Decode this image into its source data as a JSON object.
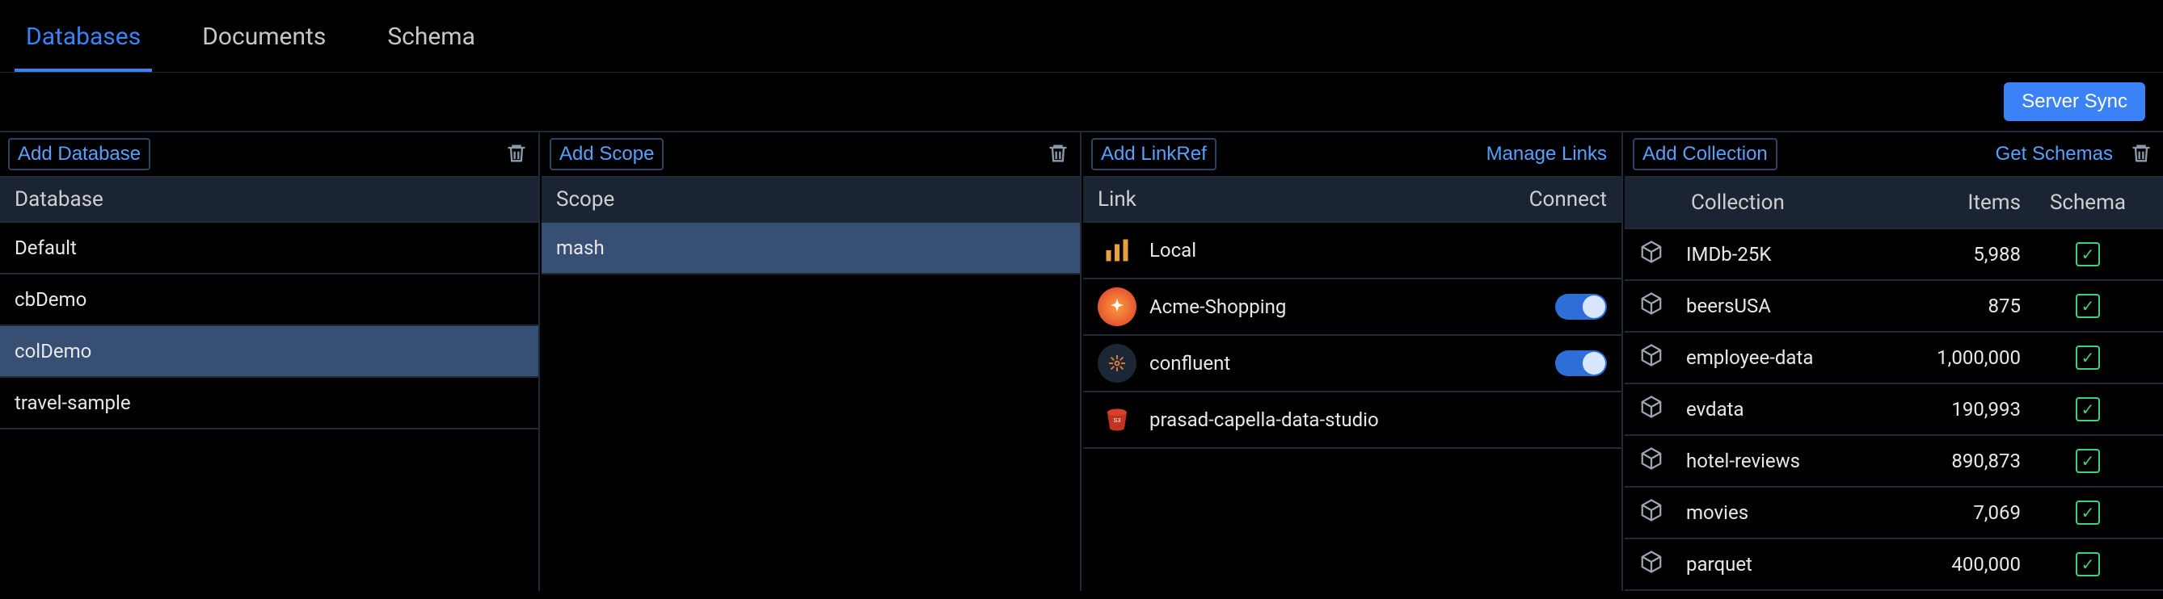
{
  "tabs": {
    "databases": "Databases",
    "documents": "Documents",
    "schema": "Schema"
  },
  "server_sync": "Server Sync",
  "actions": {
    "add_database": "Add Database",
    "add_scope": "Add Scope",
    "add_linkref": "Add LinkRef",
    "manage_links": "Manage Links",
    "add_collection": "Add Collection",
    "get_schemas": "Get Schemas"
  },
  "headers": {
    "database": "Database",
    "scope": "Scope",
    "link": "Link",
    "connect": "Connect",
    "collection": "Collection",
    "items": "Items",
    "schema": "Schema"
  },
  "databases": [
    {
      "name": "Default",
      "selected": false
    },
    {
      "name": "cbDemo",
      "selected": false
    },
    {
      "name": "colDemo",
      "selected": true
    },
    {
      "name": "travel-sample",
      "selected": false
    }
  ],
  "scopes": [
    {
      "name": "mash",
      "selected": true
    }
  ],
  "links": [
    {
      "name": "Local",
      "kind": "local",
      "toggle": null
    },
    {
      "name": "Acme-Shopping",
      "kind": "acme",
      "toggle": true
    },
    {
      "name": "confluent",
      "kind": "confluent",
      "toggle": true
    },
    {
      "name": "prasad-capella-data-studio",
      "kind": "s3",
      "toggle": null
    }
  ],
  "collections": [
    {
      "name": "IMDb-25K",
      "items": "5,988",
      "schema": true
    },
    {
      "name": "beersUSA",
      "items": "875",
      "schema": true
    },
    {
      "name": "employee-data",
      "items": "1,000,000",
      "schema": true
    },
    {
      "name": "evdata",
      "items": "190,993",
      "schema": true
    },
    {
      "name": "hotel-reviews",
      "items": "890,873",
      "schema": true
    },
    {
      "name": "movies",
      "items": "7,069",
      "schema": true
    },
    {
      "name": "parquet",
      "items": "400,000",
      "schema": true
    }
  ]
}
